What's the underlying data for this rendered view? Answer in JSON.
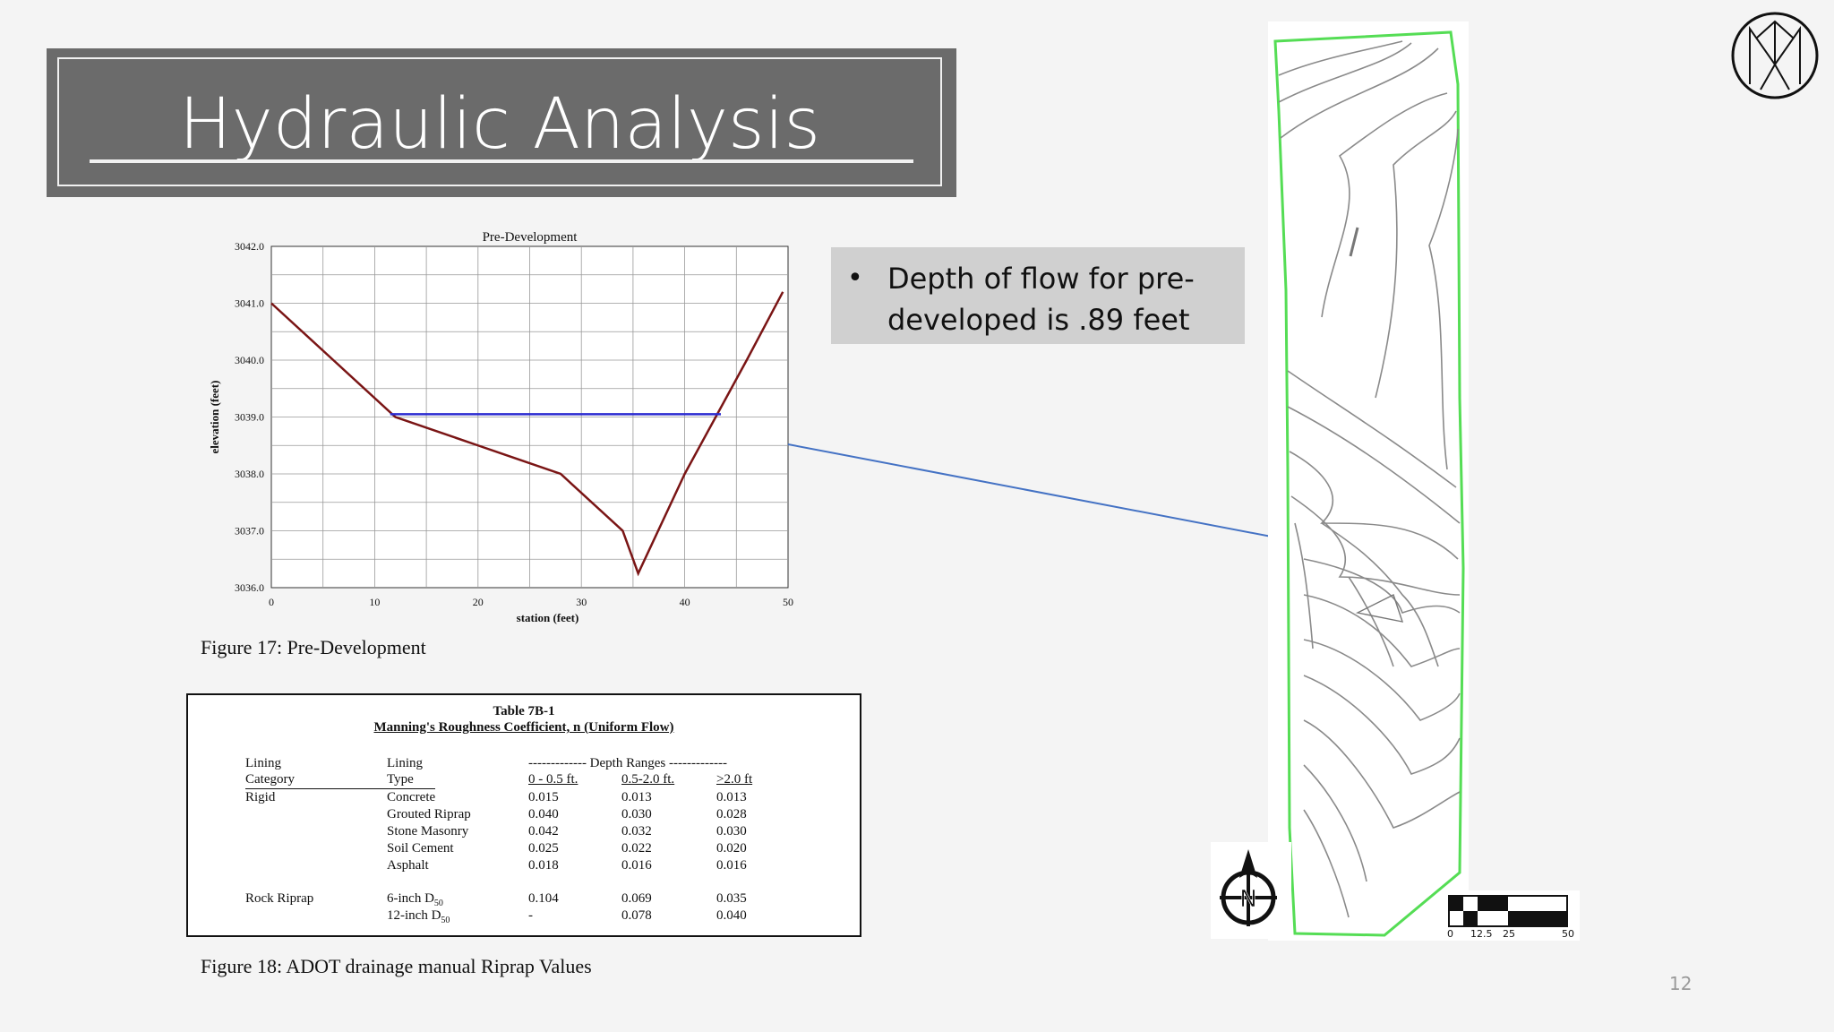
{
  "slide": {
    "title": "Hydraulic Analysis",
    "page_number": "12",
    "logo_icon": "circular-monogram-logo",
    "bullet": {
      "text": "Depth of flow for pre-developed is .89 feet"
    },
    "figure17_caption": "Figure 17: Pre-Development",
    "figure18_caption": "Figure 18: ADOT drainage manual Riprap Values",
    "map": {
      "compass_letter": "N",
      "scale_labels": [
        "0",
        "12.5",
        "25",
        "50"
      ],
      "boundary_color": "#55dd55"
    },
    "colors": {
      "title_bg": "#6b6b6b",
      "bullet_bg": "#d0d0d0",
      "ground_line": "#7a1515",
      "water_line": "#2b2bd0",
      "arrow": "#4472c4"
    }
  },
  "table": {
    "title": "Table 7B-1",
    "subtitle": "Manning's Roughness Coefficient, n  (Uniform Flow)",
    "header_row1": [
      "Lining",
      "Lining",
      "------------- Depth Ranges -------------"
    ],
    "header_row2": [
      "Category",
      "Type",
      "0 - 0.5 ft.",
      "0.5-2.0 ft.",
      ">2.0 ft"
    ],
    "rows": [
      {
        "category": "Rigid",
        "type": "Concrete",
        "v1": "0.015",
        "v2": "0.013",
        "v3": "0.013"
      },
      {
        "category": "",
        "type": "Grouted Riprap",
        "v1": "0.040",
        "v2": "0.030",
        "v3": "0.028"
      },
      {
        "category": "",
        "type": "Stone Masonry",
        "v1": "0.042",
        "v2": "0.032",
        "v3": "0.030"
      },
      {
        "category": "",
        "type": "Soil Cement",
        "v1": "0.025",
        "v2": "0.022",
        "v3": "0.020"
      },
      {
        "category": "",
        "type": "Asphalt",
        "v1": "0.018",
        "v2": "0.016",
        "v3": "0.016"
      },
      {
        "category": "Rock Riprap",
        "type": "6-inch D50",
        "v1": "0.104",
        "v2": "0.069",
        "v3": "0.035"
      },
      {
        "category": "",
        "type": "12-inch D50",
        "v1": "-",
        "v2": "0.078",
        "v3": "0.040"
      }
    ]
  },
  "chart_data": {
    "type": "line",
    "title": "Pre-Development",
    "xlabel": "station (feet)",
    "ylabel": "elevation (feet)",
    "xlim": [
      0,
      50
    ],
    "ylim": [
      3036.0,
      3042.0
    ],
    "x_ticks": [
      "0",
      "10",
      "20",
      "30",
      "40",
      "50"
    ],
    "y_ticks": [
      "3036.0",
      "3037.0",
      "3038.0",
      "3039.0",
      "3040.0",
      "3041.0",
      "3042.0"
    ],
    "grid": true,
    "series": [
      {
        "role": "ground",
        "color": "#7a1515",
        "x": [
          0,
          6,
          12,
          20,
          28,
          34,
          35.5,
          40,
          46,
          49.5
        ],
        "y": [
          3041.0,
          3040.0,
          3039.0,
          3038.5,
          3038.0,
          3037.0,
          3036.25,
          3038.0,
          3040.0,
          3041.2
        ]
      },
      {
        "role": "water",
        "color": "#2b2bd0",
        "x": [
          11.5,
          43.5
        ],
        "y": [
          3039.05,
          3039.05
        ]
      }
    ]
  }
}
